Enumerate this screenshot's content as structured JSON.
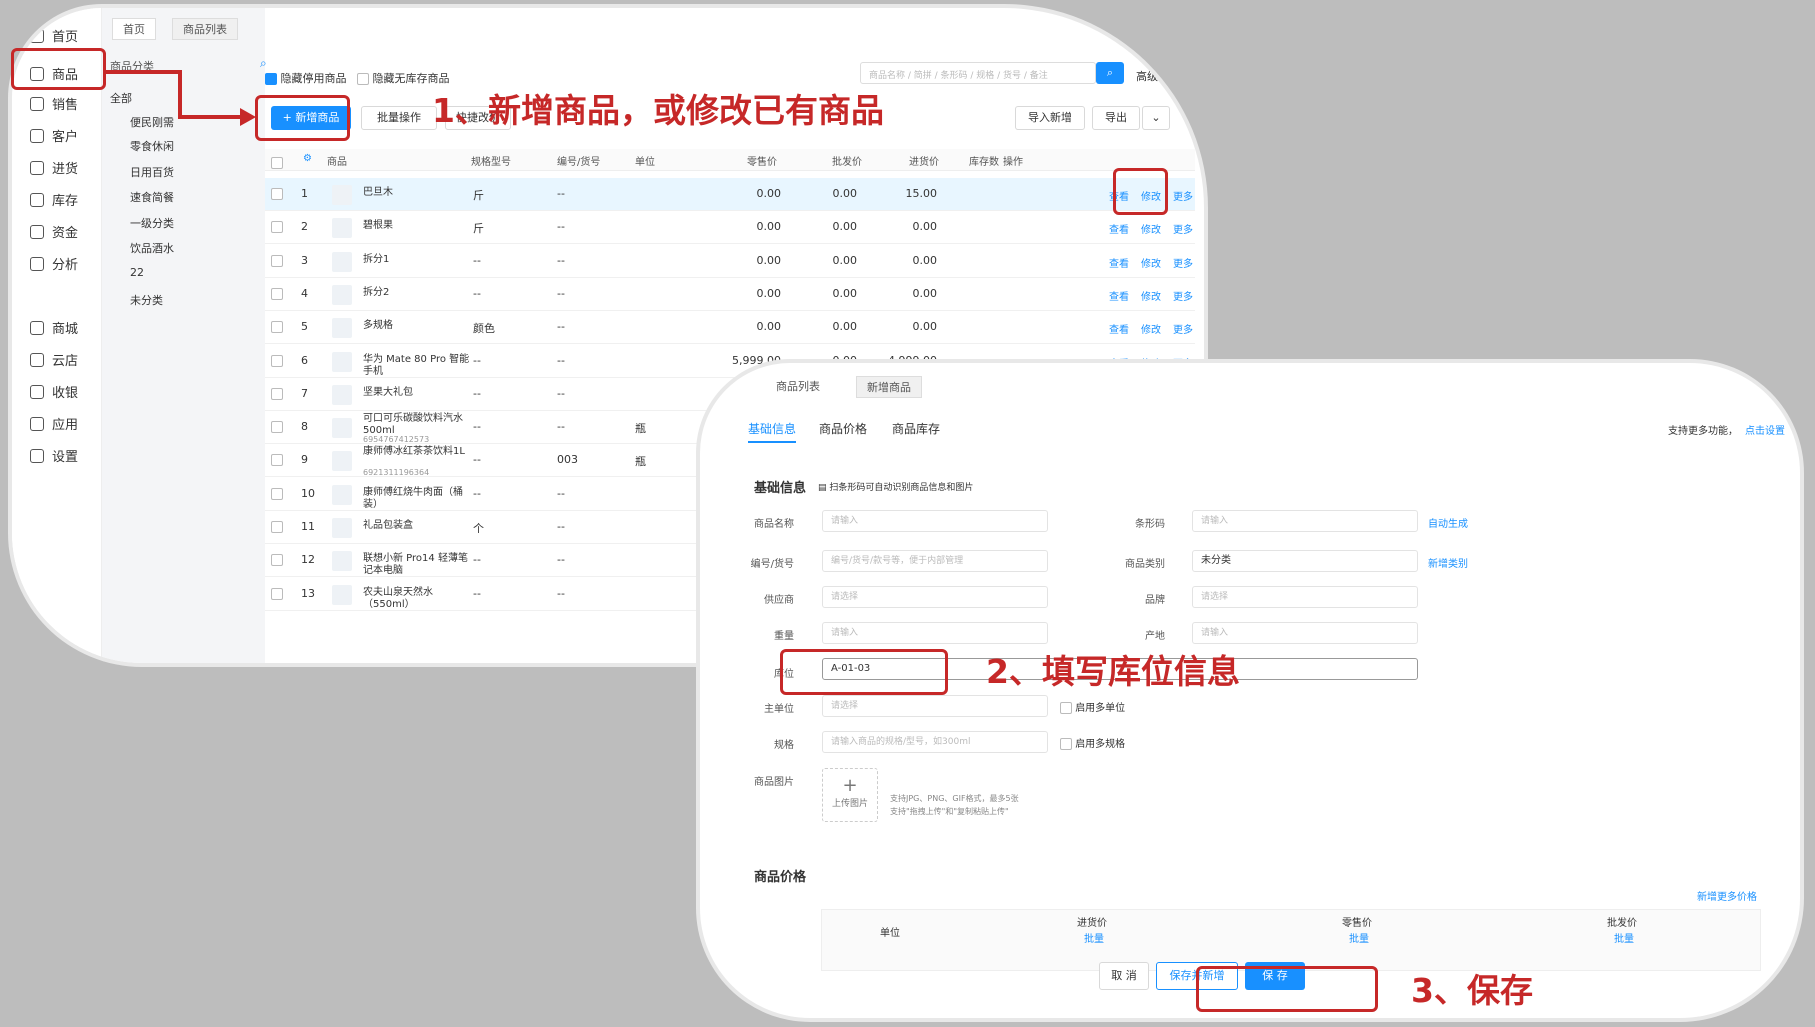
{
  "panel1": {
    "sidebar": [
      {
        "label": "首页",
        "icon": "home-icon"
      },
      {
        "label": "商品",
        "icon": "box-icon"
      },
      {
        "label": "销售",
        "icon": "sales-icon"
      },
      {
        "label": "客户",
        "icon": "user-icon"
      },
      {
        "label": "进货",
        "icon": "purchase-icon"
      },
      {
        "label": "库存",
        "icon": "warehouse-icon"
      },
      {
        "label": "资金",
        "icon": "wallet-icon"
      },
      {
        "label": "分析",
        "icon": "chart-icon"
      },
      {
        "label": "商城",
        "icon": "store-icon"
      },
      {
        "label": "云店",
        "icon": "cloud-store-icon"
      },
      {
        "label": "收银",
        "icon": "cashier-icon"
      },
      {
        "label": "应用",
        "icon": "apps-icon"
      },
      {
        "label": "设置",
        "icon": "gear-icon"
      }
    ],
    "category_title": "商品分类",
    "categories": [
      "全部",
      "便民刚需",
      "零食休闲",
      "日用百货",
      "速食简餐",
      "一级分类",
      "饮品酒水",
      "22",
      "未分类"
    ],
    "tabs": [
      "首页",
      "商品列表"
    ],
    "filters": {
      "hide_disabled": "隐藏停用商品",
      "hide_no_stock": "隐藏无库存商品"
    },
    "search_placeholder": "商品名称 / 简拼 / 条形码 / 规格 / 货号 / 备注",
    "advanced_search": "高级查询",
    "toolbar": {
      "add": "+ 新增商品",
      "batch": "批量操作",
      "quick_edit": "快捷改价",
      "import": "导入新增",
      "export": "导出"
    },
    "columns": [
      "商品",
      "规格型号",
      "编号/货号",
      "单位",
      "零售价",
      "批发价",
      "进货价",
      "库存数",
      "操作"
    ],
    "rows": [
      {
        "idx": "1",
        "name": "巴旦木",
        "sub": "",
        "spec": "斤",
        "code": "--",
        "unit": "",
        "retail": "0.00",
        "wholesale": "0.00",
        "cost": "15.00"
      },
      {
        "idx": "2",
        "name": "碧根果",
        "sub": "",
        "spec": "斤",
        "code": "--",
        "unit": "",
        "retail": "0.00",
        "wholesale": "0.00",
        "cost": "0.00"
      },
      {
        "idx": "3",
        "name": "拆分1",
        "sub": "",
        "spec": "--",
        "code": "--",
        "unit": "",
        "retail": "0.00",
        "wholesale": "0.00",
        "cost": "0.00"
      },
      {
        "idx": "4",
        "name": "拆分2",
        "sub": "",
        "spec": "--",
        "code": "--",
        "unit": "",
        "retail": "0.00",
        "wholesale": "0.00",
        "cost": "0.00"
      },
      {
        "idx": "5",
        "name": "多规格",
        "sub": "",
        "spec": "颜色",
        "code": "--",
        "unit": "",
        "retail": "0.00",
        "wholesale": "0.00",
        "cost": "0.00"
      },
      {
        "idx": "6",
        "name": "华为 Mate 80 Pro 智能手机",
        "sub": "",
        "spec": "--",
        "code": "--",
        "unit": "",
        "retail": "5,999.00",
        "wholesale": "0.00",
        "cost": "4,999.00"
      },
      {
        "idx": "7",
        "name": "坚果大礼包",
        "sub": "",
        "spec": "--",
        "code": "--",
        "unit": "",
        "retail": "",
        "wholesale": "",
        "cost": ""
      },
      {
        "idx": "8",
        "name": "可口可乐碳酸饮料汽水500ml",
        "sub": "6954767412573",
        "spec": "--",
        "code": "--",
        "unit": "瓶",
        "retail": "",
        "wholesale": "",
        "cost": ""
      },
      {
        "idx": "9",
        "name": "康师傅冰红茶茶饮料1L",
        "sub": "6921311196364",
        "spec": "--",
        "code": "003",
        "unit": "瓶",
        "retail": "",
        "wholesale": "",
        "cost": ""
      },
      {
        "idx": "10",
        "name": "康师傅红烧牛肉面（桶装）",
        "sub": "",
        "spec": "--",
        "code": "--",
        "unit": "",
        "retail": "",
        "wholesale": "",
        "cost": ""
      },
      {
        "idx": "11",
        "name": "礼品包装盒",
        "sub": "",
        "spec": "个",
        "code": "--",
        "unit": "",
        "retail": "",
        "wholesale": "",
        "cost": ""
      },
      {
        "idx": "12",
        "name": "联想小新 Pro14 轻薄笔记本电脑",
        "sub": "",
        "spec": "--",
        "code": "--",
        "unit": "",
        "retail": "",
        "wholesale": "",
        "cost": ""
      },
      {
        "idx": "13",
        "name": "农夫山泉天然水（550ml）",
        "sub": "",
        "spec": "--",
        "code": "--",
        "unit": "",
        "retail": "",
        "wholesale": "",
        "cost": ""
      }
    ],
    "actions": {
      "view": "查看",
      "edit": "修改",
      "more": "更多"
    }
  },
  "panel2": {
    "tabs": [
      "首页",
      "商品列表",
      "新增商品"
    ],
    "subtabs": [
      "基础信息",
      "商品价格",
      "商品库存"
    ],
    "more_features": "支持更多功能，",
    "more_features_link": "点击设置",
    "section_basic": "基础信息",
    "scan_tip": "扫条形码可自动识别商品信息和图片",
    "fields": {
      "name_label": "商品名称",
      "name_ph": "请输入",
      "barcode_label": "条形码",
      "barcode_ph": "请输入",
      "barcode_link": "自动生成",
      "code_label": "编号/货号",
      "code_ph": "编号/货号/款号等，便于内部管理",
      "category_label": "商品类别",
      "category_val": "未分类",
      "category_link": "新增类别",
      "supplier_label": "供应商",
      "supplier_ph": "请选择",
      "brand_label": "品牌",
      "brand_ph": "请选择",
      "weight_label": "重量",
      "weight_ph": "请输入",
      "origin_label": "产地",
      "origin_ph": "请输入",
      "location_label": "库位",
      "location_val": "A-01-03",
      "unit_label": "主单位",
      "unit_ph": "请选择",
      "multi_unit": "启用多单位",
      "spec_label": "规格",
      "spec_ph": "请输入商品的规格/型号，如300ml",
      "multi_spec": "启用多规格",
      "image_label": "商品图片",
      "upload": "上传图片",
      "upload_tip1": "支持JPG、PNG、GIF格式，最多5张",
      "upload_tip2": "支持\"拖拽上传\"和\"复制粘贴上传\""
    },
    "section_price": "商品价格",
    "more_prices": "新增更多价格",
    "price_cols": [
      "单位",
      "进货价",
      "零售价",
      "批发价"
    ],
    "price_batch": "批量",
    "buttons": {
      "cancel": "取 消",
      "save_new": "保存并新增",
      "save": "保 存"
    }
  },
  "annotations": {
    "step1": "1、新增商品，或修改已有商品",
    "step2": "2、填写库位信息",
    "step3": "3、保存"
  },
  "colors": {
    "accent": "#1890ff",
    "annotation_red": "#c62828"
  }
}
